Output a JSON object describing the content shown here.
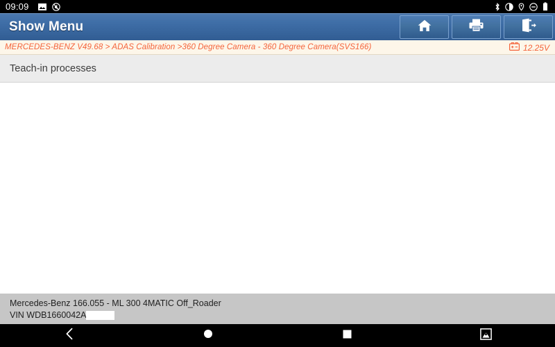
{
  "status_bar": {
    "clock": "09:09",
    "left_icons": [
      "screenshot-icon",
      "mute-icon"
    ],
    "right_icons": [
      "bluetooth-icon",
      "brightness-icon",
      "location-icon",
      "do-not-disturb-icon",
      "battery-icon"
    ]
  },
  "header": {
    "title": "Show Menu",
    "buttons": [
      {
        "name": "home-button",
        "icon": "home-icon"
      },
      {
        "name": "print-button",
        "icon": "printer-icon"
      },
      {
        "name": "exit-button",
        "icon": "exit-icon"
      }
    ]
  },
  "breadcrumb": {
    "path": "MERCEDES-BENZ V49.68 > ADAS Calibration >360 Degree  Camera - 360 Degree  Camera(SVS166)",
    "voltage": "12.25V",
    "voltage_icon": "battery-voltage-icon",
    "color": "#f4633a"
  },
  "menu": {
    "items": [
      {
        "label": "Teach-in processes"
      }
    ]
  },
  "vehicle_info": {
    "model": "Mercedes-Benz 166.055 - ML 300 4MATIC Off_Roader",
    "vin_label": "VIN WDB1660042A"
  },
  "nav_bar": {
    "buttons": [
      {
        "name": "nav-back-button",
        "icon": "chevron-left-icon"
      },
      {
        "name": "nav-home-button",
        "icon": "circle-icon"
      },
      {
        "name": "nav-recents-button",
        "icon": "square-icon"
      },
      {
        "name": "nav-screenshot-button",
        "icon": "screenshot-capture-icon"
      }
    ]
  }
}
